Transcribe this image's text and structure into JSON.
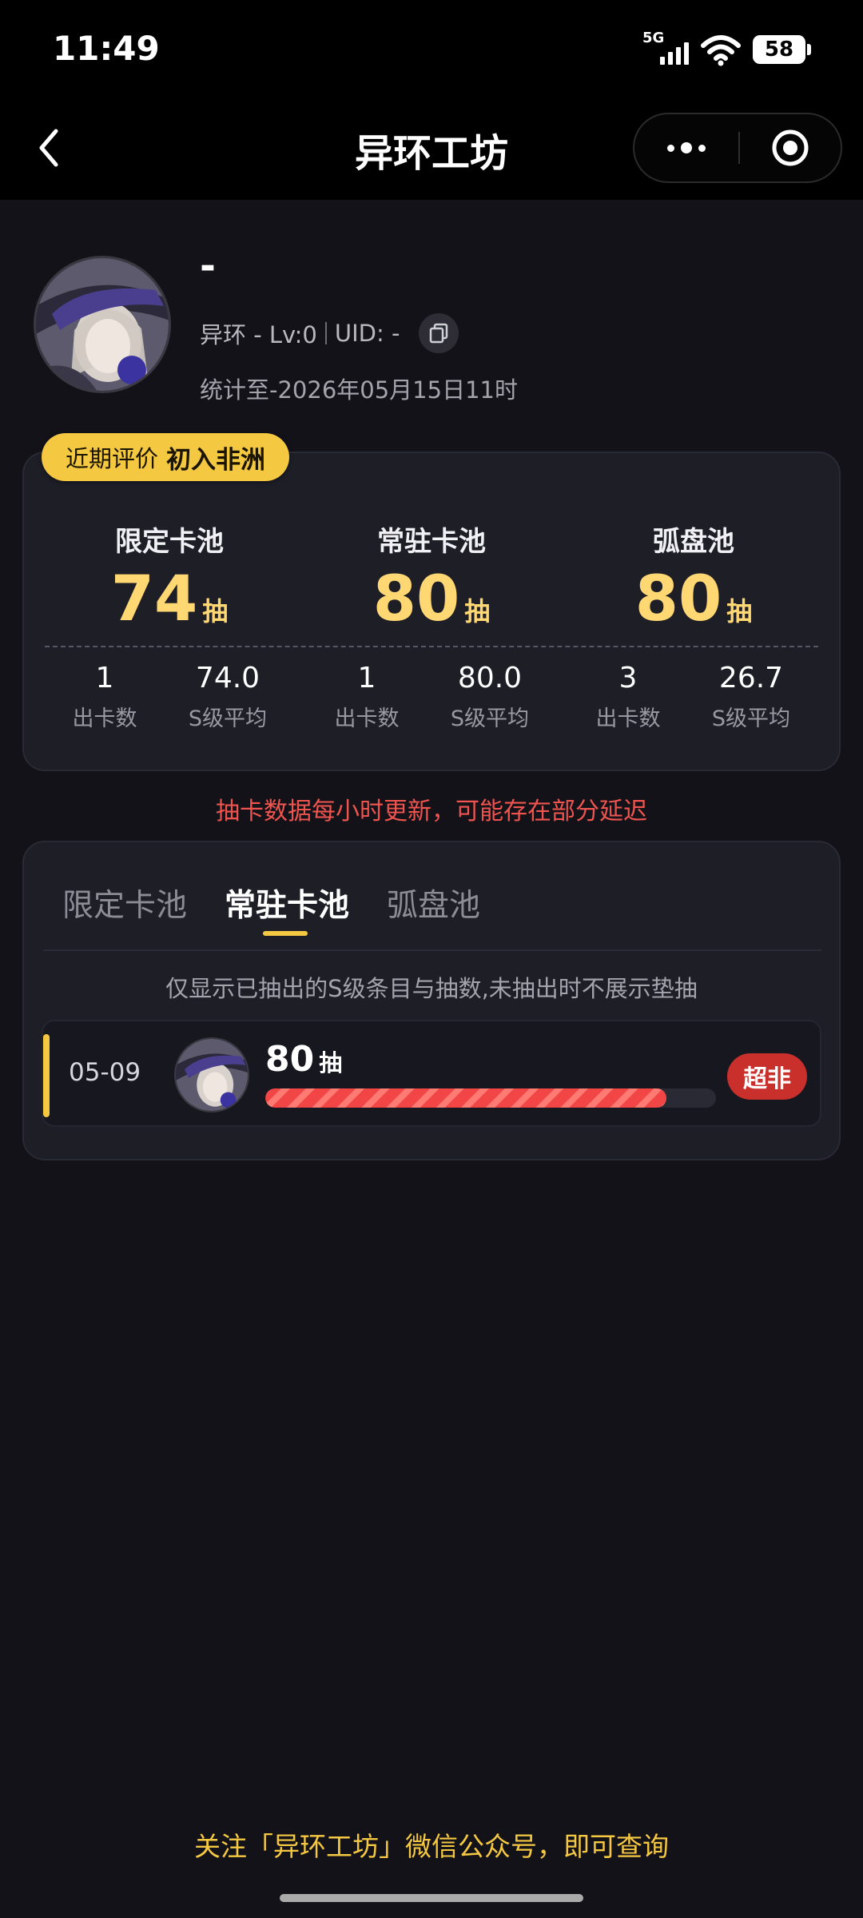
{
  "status_bar": {
    "time": "11:49",
    "network": "5G",
    "battery": "58"
  },
  "nav": {
    "title": "异环工坊",
    "back_icon": "chevron-left-icon",
    "more_icon": "more-dots-icon",
    "close_icon": "target-close-icon"
  },
  "profile": {
    "name": "-",
    "meta_game": "异环 - Lv:0",
    "meta_uid": "UID: -",
    "stats_date": "统计至-2026年05月15日11时"
  },
  "rating": {
    "label": "近期评价",
    "value": "初入非洲"
  },
  "pools": [
    {
      "name": "限定卡池",
      "count": "74",
      "unit": "抽",
      "cards_value": "1",
      "cards_label": "出卡数",
      "avg_value": "74.0",
      "avg_label": "S级平均"
    },
    {
      "name": "常驻卡池",
      "count": "80",
      "unit": "抽",
      "cards_value": "1",
      "cards_label": "出卡数",
      "avg_value": "80.0",
      "avg_label": "S级平均"
    },
    {
      "name": "弧盘池",
      "count": "80",
      "unit": "抽",
      "cards_value": "3",
      "cards_label": "出卡数",
      "avg_value": "26.7",
      "avg_label": "S级平均"
    }
  ],
  "notice": "抽卡数据每小时更新，可能存在部分延迟",
  "tabs": [
    {
      "label": "限定卡池"
    },
    {
      "label": "常驻卡池"
    },
    {
      "label": "弧盘池"
    }
  ],
  "active_tab": "常驻卡池",
  "hint": "仅显示已抽出的S级条目与抽数,未抽出时不展示垫抽",
  "records": [
    {
      "date": "05-09",
      "pulls": "80",
      "unit": "抽",
      "progress": 0.89,
      "rank": "超非"
    }
  ],
  "footer": "关注「异环工坊」微信公众号，即可查询",
  "colors": {
    "accent": "#f5c842",
    "number": "#ffd873",
    "warning": "#f0544f",
    "rank_bad": "#c9302c",
    "background": "#141219",
    "card": "#1e1e27"
  }
}
